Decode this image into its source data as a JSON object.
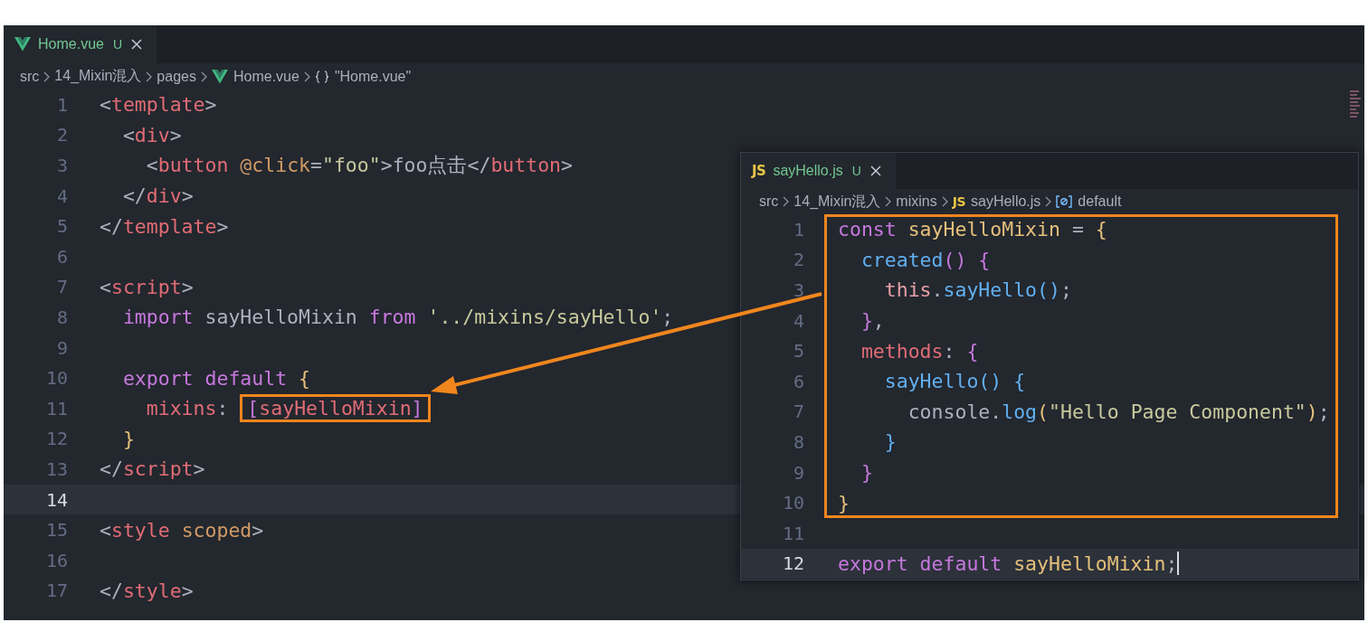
{
  "editors": [
    {
      "tab": {
        "kind": "vue",
        "label": "Home.vue",
        "status": "U",
        "selected": true
      },
      "breadcrumb": [
        {
          "kind": "folder",
          "text": "src"
        },
        {
          "kind": "folder",
          "text": "14_Mixin混入"
        },
        {
          "kind": "folder",
          "text": "pages"
        },
        {
          "kind": "vue",
          "text": "Home.vue"
        },
        {
          "kind": "object",
          "text": "\"Home.vue\""
        }
      ],
      "lines": [
        {
          "number": "1",
          "current": false,
          "tokens": [
            {
              "kind": "punct",
              "text": "<"
            },
            {
              "kind": "tag",
              "text": "template"
            },
            {
              "kind": "punct",
              "text": ">"
            }
          ]
        },
        {
          "number": "2",
          "current": false,
          "tokens": [
            {
              "kind": "punct",
              "text": "  <"
            },
            {
              "kind": "tag",
              "text": "div"
            },
            {
              "kind": "punct",
              "text": ">"
            }
          ]
        },
        {
          "number": "3",
          "current": false,
          "tokens": [
            {
              "kind": "punct",
              "text": "    <"
            },
            {
              "kind": "tag",
              "text": "button"
            },
            {
              "kind": "attr",
              "text": " @click"
            },
            {
              "kind": "punct",
              "text": "="
            },
            {
              "kind": "string",
              "text": "\"foo\""
            },
            {
              "kind": "punct",
              "text": ">"
            },
            {
              "kind": "plain",
              "text": "foo点击"
            },
            {
              "kind": "punct",
              "text": "</"
            },
            {
              "kind": "tag",
              "text": "button"
            },
            {
              "kind": "punct",
              "text": ">"
            }
          ]
        },
        {
          "number": "4",
          "current": false,
          "tokens": [
            {
              "kind": "punct",
              "text": "  </"
            },
            {
              "kind": "tag",
              "text": "div"
            },
            {
              "kind": "punct",
              "text": ">"
            }
          ]
        },
        {
          "number": "5",
          "current": false,
          "tokens": [
            {
              "kind": "punct",
              "text": "</"
            },
            {
              "kind": "tag",
              "text": "template"
            },
            {
              "kind": "punct",
              "text": ">"
            }
          ]
        },
        {
          "number": "6",
          "current": false
        },
        {
          "number": "7",
          "current": false,
          "tokens": [
            {
              "kind": "punct",
              "text": "<"
            },
            {
              "kind": "tag",
              "text": "script"
            },
            {
              "kind": "punct",
              "text": ">"
            }
          ]
        },
        {
          "number": "8",
          "current": false,
          "tokens": [
            {
              "kind": "keyword",
              "text": "  import"
            },
            {
              "kind": "plain",
              "text": " sayHelloMixin"
            },
            {
              "kind": "keyword",
              "text": " from"
            },
            {
              "kind": "string",
              "text": " '../mixins/sayHello'"
            },
            {
              "kind": "punct",
              "text": ";"
            }
          ]
        },
        {
          "number": "9",
          "current": false
        },
        {
          "number": "10",
          "current": false,
          "tokens": [
            {
              "kind": "keyword",
              "text": "  export"
            },
            {
              "kind": "keyword",
              "text": " default"
            },
            {
              "kind": "brace1",
              "text": " {"
            }
          ]
        },
        {
          "number": "11",
          "current": false,
          "tokens": [
            {
              "kind": "prop",
              "text": "    mixins"
            },
            {
              "kind": "punct",
              "text": ": "
            },
            {
              "kind": "brace2",
              "text": "[",
              "boxed": true
            },
            {
              "kind": "prop",
              "text": "sayHelloMixin",
              "boxed": true
            },
            {
              "kind": "brace2",
              "text": "]",
              "boxed": true
            }
          ]
        },
        {
          "number": "12",
          "current": false,
          "tokens": [
            {
              "kind": "brace1",
              "text": "  }"
            }
          ]
        },
        {
          "number": "13",
          "current": false,
          "tokens": [
            {
              "kind": "punct",
              "text": "</"
            },
            {
              "kind": "tag",
              "text": "script"
            },
            {
              "kind": "punct",
              "text": ">"
            }
          ]
        },
        {
          "number": "14",
          "current": true
        },
        {
          "number": "15",
          "current": false,
          "tokens": [
            {
              "kind": "punct",
              "text": "<"
            },
            {
              "kind": "tag",
              "text": "style"
            },
            {
              "kind": "attr",
              "text": " scoped"
            },
            {
              "kind": "punct",
              "text": ">"
            }
          ]
        },
        {
          "number": "16",
          "current": false
        },
        {
          "number": "17",
          "current": false,
          "tokens": [
            {
              "kind": "punct",
              "text": "</"
            },
            {
              "kind": "tag",
              "text": "style"
            },
            {
              "kind": "punct",
              "text": ">"
            }
          ]
        }
      ]
    },
    {
      "tab": {
        "kind": "js",
        "badge": "JS",
        "label": "sayHello.js",
        "status": "U",
        "selected": true
      },
      "breadcrumb": [
        {
          "kind": "folder",
          "text": "src"
        },
        {
          "kind": "folder",
          "text": "14_Mixin混入"
        },
        {
          "kind": "folder",
          "text": "mixins"
        },
        {
          "kind": "js",
          "badge": "JS",
          "text": "sayHello.js"
        },
        {
          "kind": "symbol",
          "text": "default"
        }
      ],
      "lines": [
        {
          "number": "1",
          "current": false,
          "boxed": true,
          "tokens": [
            {
              "kind": "keyword",
              "text": "const"
            },
            {
              "kind": "var",
              "text": " sayHelloMixin"
            },
            {
              "kind": "punct",
              "text": " ="
            },
            {
              "kind": "brace1",
              "text": " {"
            }
          ]
        },
        {
          "number": "2",
          "current": false,
          "boxed": true,
          "tokens": [
            {
              "kind": "func",
              "text": "  created"
            },
            {
              "kind": "brace2",
              "text": "()"
            },
            {
              "kind": "brace2",
              "text": " {"
            }
          ]
        },
        {
          "number": "3",
          "current": false,
          "boxed": true,
          "tokens": [
            {
              "kind": "self",
              "text": "    this"
            },
            {
              "kind": "punct",
              "text": "."
            },
            {
              "kind": "func",
              "text": "sayHello"
            },
            {
              "kind": "brace3",
              "text": "()"
            },
            {
              "kind": "punct",
              "text": ";"
            }
          ]
        },
        {
          "number": "4",
          "current": false,
          "boxed": true,
          "tokens": [
            {
              "kind": "brace2",
              "text": "  }"
            },
            {
              "kind": "punct",
              "text": ","
            }
          ]
        },
        {
          "number": "5",
          "current": false,
          "boxed": true,
          "tokens": [
            {
              "kind": "prop",
              "text": "  methods"
            },
            {
              "kind": "punct",
              "text": ":"
            },
            {
              "kind": "brace2",
              "text": " {"
            }
          ]
        },
        {
          "number": "6",
          "current": false,
          "boxed": true,
          "tokens": [
            {
              "kind": "func",
              "text": "    sayHello"
            },
            {
              "kind": "brace3",
              "text": "()"
            },
            {
              "kind": "brace3",
              "text": " {"
            }
          ]
        },
        {
          "number": "7",
          "current": false,
          "boxed": true,
          "tokens": [
            {
              "kind": "plain",
              "text": "      console"
            },
            {
              "kind": "punct",
              "text": "."
            },
            {
              "kind": "func",
              "text": "log"
            },
            {
              "kind": "brace1",
              "text": "("
            },
            {
              "kind": "string",
              "text": "\"Hello Page Component\""
            },
            {
              "kind": "brace1",
              "text": ")"
            },
            {
              "kind": "punct",
              "text": ";"
            }
          ]
        },
        {
          "number": "8",
          "current": false,
          "boxed": true,
          "tokens": [
            {
              "kind": "brace3",
              "text": "    }"
            }
          ]
        },
        {
          "number": "9",
          "current": false,
          "boxed": true,
          "tokens": [
            {
              "kind": "brace2",
              "text": "  }"
            }
          ]
        },
        {
          "number": "10",
          "current": false,
          "boxed": true,
          "tokens": [
            {
              "kind": "brace1",
              "text": "}"
            }
          ]
        },
        {
          "number": "11",
          "current": false,
          "boxed": false
        },
        {
          "number": "12",
          "current": true,
          "boxed": false,
          "cursor": true,
          "tokens": [
            {
              "kind": "keyword",
              "text": "export"
            },
            {
              "kind": "keyword",
              "text": " default"
            },
            {
              "kind": "var",
              "text": " sayHelloMixin"
            },
            {
              "kind": "punct",
              "text": ";"
            }
          ]
        }
      ]
    }
  ]
}
